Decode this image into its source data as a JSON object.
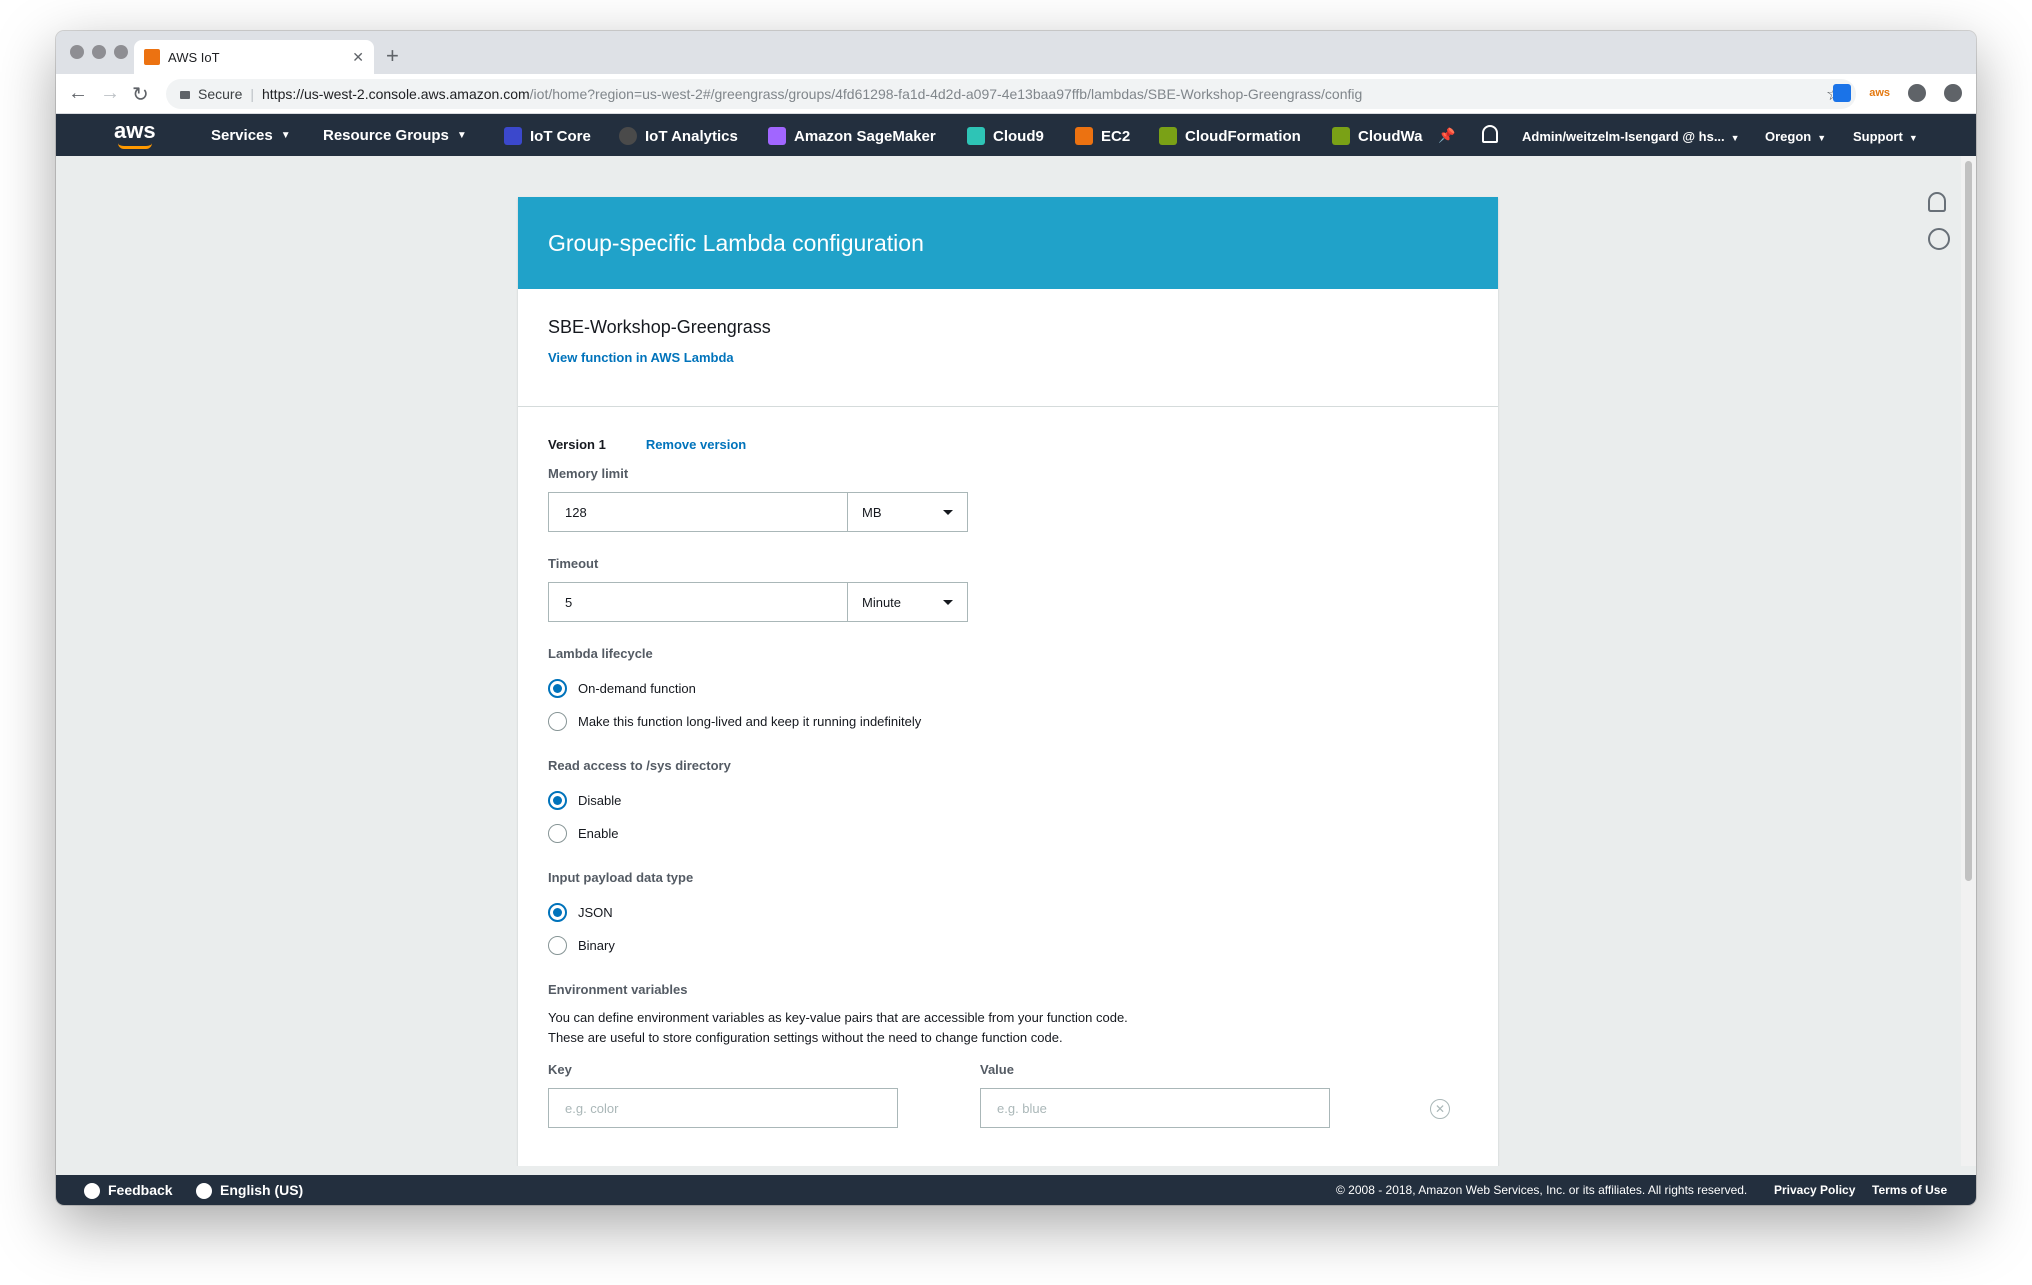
{
  "browser": {
    "tab_title": "AWS IoT",
    "new_tab": "+",
    "secure_label": "Secure",
    "url_host": "https://us-west-2.console.aws.amazon.com",
    "url_path": "/iot/home?region=us-west-2#/greengrass/groups/4fd61298-fa1d-4d2d-a097-4e13baa97ffb/lambdas/SBE-Workshop-Greengrass/config",
    "amz_ext": "aws"
  },
  "aws_nav": {
    "logo": "aws",
    "services": "Services",
    "resource_groups": "Resource Groups",
    "shortcuts": [
      {
        "label": "IoT Core",
        "color": "#3b48cc"
      },
      {
        "label": "IoT Analytics",
        "color": "#7a7a7a"
      },
      {
        "label": "Amazon SageMaker",
        "color": "#a166ff"
      },
      {
        "label": "Cloud9",
        "color": "#2ec4b6"
      },
      {
        "label": "EC2",
        "color": "#ec7211"
      },
      {
        "label": "CloudFormation",
        "color": "#7aa116"
      },
      {
        "label": "CloudWa",
        "color": "#7aa116"
      }
    ],
    "account": "Admin/weitzelm-Isengard @ hs...",
    "region": "Oregon",
    "support": "Support"
  },
  "card": {
    "header": "Group-specific Lambda configuration",
    "function_name": "SBE-Workshop-Greengrass",
    "view_link": "View function in AWS Lambda",
    "version_label": "Version 1",
    "remove_version": "Remove version",
    "memory_label": "Memory limit",
    "memory_value": "128",
    "memory_unit": "MB",
    "timeout_label": "Timeout",
    "timeout_value": "5",
    "timeout_unit": "Minute",
    "lifecycle_label": "Lambda lifecycle",
    "lifecycle_options": [
      "On-demand function",
      "Make this function long-lived and keep it running indefinitely"
    ],
    "sys_label": "Read access to /sys directory",
    "sys_options": [
      "Disable",
      "Enable"
    ],
    "payload_label": "Input payload data type",
    "payload_options": [
      "JSON",
      "Binary"
    ],
    "env_label": "Environment variables",
    "env_desc": "You can define environment variables as key-value pairs that are accessible from your function code. These are useful to store configuration settings without the need to change function code.",
    "key_label": "Key",
    "key_placeholder": "e.g. color",
    "value_label": "Value",
    "value_placeholder": "e.g. blue"
  },
  "footer": {
    "feedback": "Feedback",
    "language": "English (US)",
    "copyright": "© 2008 - 2018, Amazon Web Services, Inc. or its affiliates. All rights reserved.",
    "privacy": "Privacy Policy",
    "terms": "Terms of Use"
  },
  "colors": {
    "header_blue": "#20a2c9",
    "link_blue": "#0073bb",
    "nav_dark": "#232f3e",
    "aws_orange": "#ff9900"
  }
}
